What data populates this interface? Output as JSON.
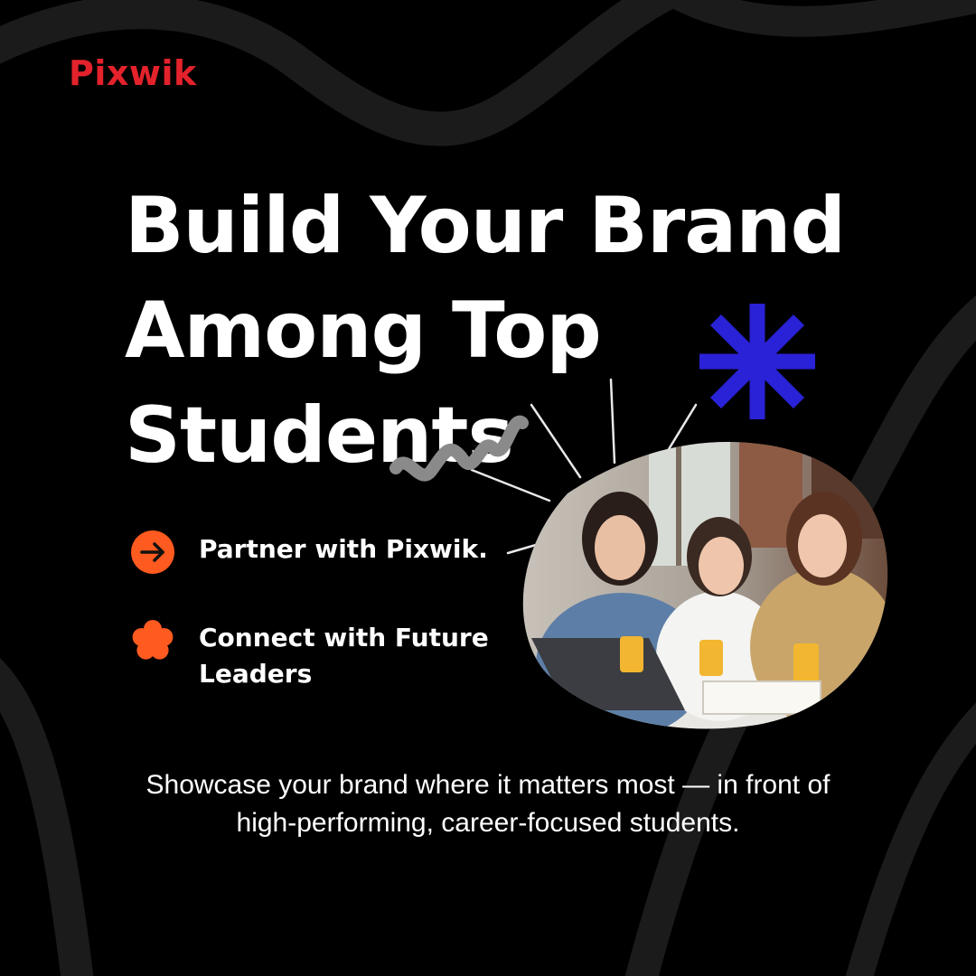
{
  "brand": {
    "logo_text": "Pixwik"
  },
  "headline": {
    "lines": [
      "Build Your Brand",
      "Among Top",
      "Students"
    ]
  },
  "features": [
    {
      "icon": "arrow-right-icon",
      "text": "Partner with Pixwik."
    },
    {
      "icon": "flower-icon",
      "text": "Connect with Future Leaders"
    }
  ],
  "tagline": {
    "line1": "Showcase your brand where it matters most — in front of",
    "line2": "high-performing, career-focused students."
  },
  "photo": {
    "description_icon": "photo-students-icon"
  },
  "colors": {
    "background": "#000000",
    "logo_red": "#e3222b",
    "accent_orange": "#ff5a1f",
    "asterisk_blue": "#2a22d6",
    "swirl_gray": "#1b1b1b",
    "squiggle_gray": "#8a8a8a"
  }
}
